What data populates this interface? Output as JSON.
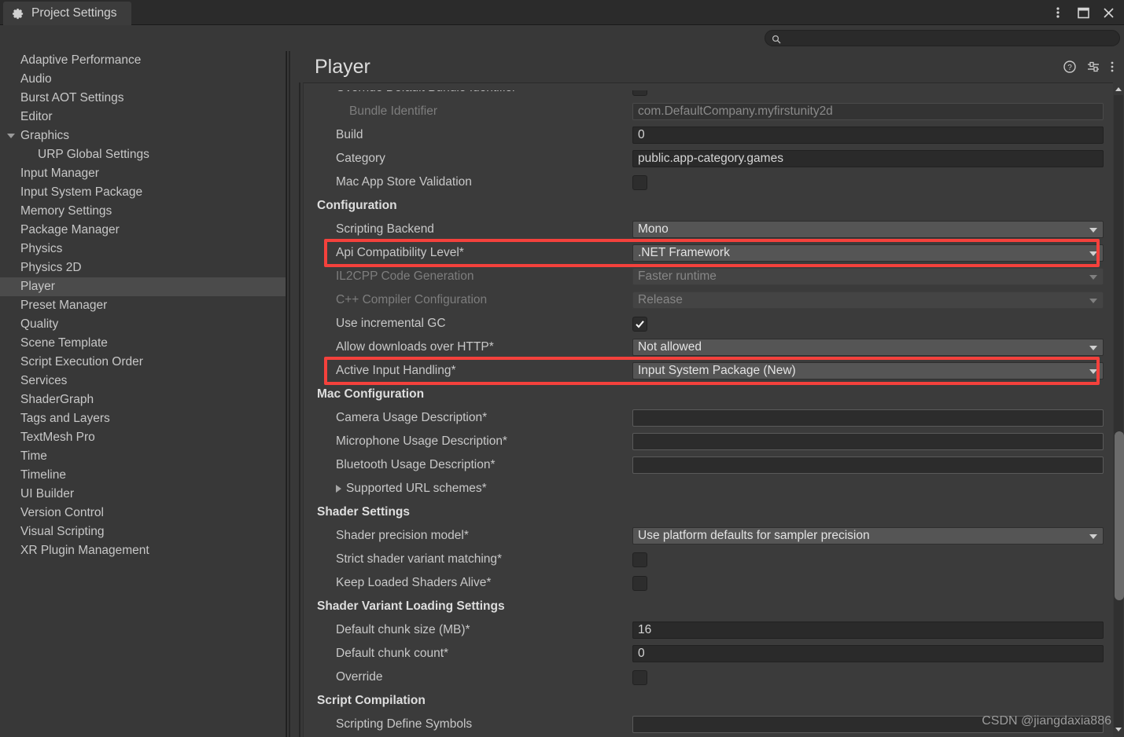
{
  "window": {
    "tab_title": "Project Settings",
    "tab_icon": "gear-icon",
    "controls": {
      "menu": "kebab-menu-icon",
      "maximize": "maximize-icon",
      "close": "close-icon"
    }
  },
  "search": {
    "placeholder": "",
    "value": "",
    "icon": "search-icon"
  },
  "sidebar": {
    "items": [
      {
        "label": "Adaptive Performance",
        "level": 0,
        "expandable": false,
        "selected": false
      },
      {
        "label": "Audio",
        "level": 0,
        "expandable": false,
        "selected": false
      },
      {
        "label": "Burst AOT Settings",
        "level": 0,
        "expandable": false,
        "selected": false
      },
      {
        "label": "Editor",
        "level": 0,
        "expandable": false,
        "selected": false
      },
      {
        "label": "Graphics",
        "level": 0,
        "expandable": true,
        "expanded": true,
        "selected": false
      },
      {
        "label": "URP Global Settings",
        "level": 1,
        "expandable": false,
        "selected": false
      },
      {
        "label": "Input Manager",
        "level": 0,
        "expandable": false,
        "selected": false
      },
      {
        "label": "Input System Package",
        "level": 0,
        "expandable": false,
        "selected": false
      },
      {
        "label": "Memory Settings",
        "level": 0,
        "expandable": false,
        "selected": false
      },
      {
        "label": "Package Manager",
        "level": 0,
        "expandable": false,
        "selected": false
      },
      {
        "label": "Physics",
        "level": 0,
        "expandable": false,
        "selected": false
      },
      {
        "label": "Physics 2D",
        "level": 0,
        "expandable": false,
        "selected": false
      },
      {
        "label": "Player",
        "level": 0,
        "expandable": false,
        "selected": true
      },
      {
        "label": "Preset Manager",
        "level": 0,
        "expandable": false,
        "selected": false
      },
      {
        "label": "Quality",
        "level": 0,
        "expandable": false,
        "selected": false
      },
      {
        "label": "Scene Template",
        "level": 0,
        "expandable": false,
        "selected": false
      },
      {
        "label": "Script Execution Order",
        "level": 0,
        "expandable": false,
        "selected": false
      },
      {
        "label": "Services",
        "level": 0,
        "expandable": false,
        "selected": false
      },
      {
        "label": "ShaderGraph",
        "level": 0,
        "expandable": false,
        "selected": false
      },
      {
        "label": "Tags and Layers",
        "level": 0,
        "expandable": false,
        "selected": false
      },
      {
        "label": "TextMesh Pro",
        "level": 0,
        "expandable": false,
        "selected": false
      },
      {
        "label": "Time",
        "level": 0,
        "expandable": false,
        "selected": false
      },
      {
        "label": "Timeline",
        "level": 0,
        "expandable": false,
        "selected": false
      },
      {
        "label": "UI Builder",
        "level": 0,
        "expandable": false,
        "selected": false
      },
      {
        "label": "Version Control",
        "level": 0,
        "expandable": false,
        "selected": false
      },
      {
        "label": "Visual Scripting",
        "level": 0,
        "expandable": false,
        "selected": false
      },
      {
        "label": "XR Plugin Management",
        "level": 0,
        "expandable": false,
        "selected": false
      }
    ]
  },
  "panel": {
    "title": "Player",
    "header_icons": [
      "help-icon",
      "preset-icon",
      "kebab-menu-icon"
    ],
    "rows": [
      {
        "kind": "checkbox",
        "label": "Override Default Bundle Identifier",
        "indent": 1,
        "checked": false,
        "disabled": false
      },
      {
        "kind": "text",
        "label": "Bundle Identifier",
        "indent": 2,
        "value": "com.DefaultCompany.myfirstunity2d",
        "disabled": true
      },
      {
        "kind": "text",
        "label": "Build",
        "indent": 1,
        "value": "0",
        "disabled": false
      },
      {
        "kind": "text",
        "label": "Category",
        "indent": 1,
        "value": "public.app-category.games",
        "disabled": false
      },
      {
        "kind": "checkbox",
        "label": "Mac App Store Validation",
        "indent": 1,
        "checked": false,
        "disabled": false
      },
      {
        "kind": "section",
        "label": "Configuration"
      },
      {
        "kind": "dropdown",
        "label": "Scripting Backend",
        "indent": 1,
        "value": "Mono",
        "disabled": false
      },
      {
        "kind": "dropdown",
        "label": "Api Compatibility Level*",
        "indent": 1,
        "value": ".NET Framework",
        "disabled": false,
        "highlight": true
      },
      {
        "kind": "dropdown",
        "label": "IL2CPP Code Generation",
        "indent": 1,
        "value": "Faster runtime",
        "disabled": true
      },
      {
        "kind": "dropdown",
        "label": "C++ Compiler Configuration",
        "indent": 1,
        "value": "Release",
        "disabled": true
      },
      {
        "kind": "checkbox",
        "label": "Use incremental GC",
        "indent": 1,
        "checked": true,
        "disabled": false
      },
      {
        "kind": "dropdown",
        "label": "Allow downloads over HTTP*",
        "indent": 1,
        "value": "Not allowed",
        "disabled": false
      },
      {
        "kind": "dropdown",
        "label": "Active Input Handling*",
        "indent": 1,
        "value": "Input System Package (New)",
        "disabled": false,
        "highlight": true
      },
      {
        "kind": "section",
        "label": "Mac Configuration"
      },
      {
        "kind": "text",
        "label": "Camera Usage Description*",
        "indent": 1,
        "value": "",
        "disabled": false
      },
      {
        "kind": "text",
        "label": "Microphone Usage Description*",
        "indent": 1,
        "value": "",
        "disabled": false
      },
      {
        "kind": "text",
        "label": "Bluetooth Usage Description*",
        "indent": 1,
        "value": "",
        "disabled": false
      },
      {
        "kind": "foldout",
        "label": "Supported URL schemes*",
        "indent": 1,
        "expanded": false
      },
      {
        "kind": "section",
        "label": "Shader Settings"
      },
      {
        "kind": "dropdown",
        "label": "Shader precision model*",
        "indent": 1,
        "value": "Use platform defaults for sampler precision",
        "disabled": false
      },
      {
        "kind": "checkbox",
        "label": "Strict shader variant matching*",
        "indent": 1,
        "checked": false,
        "disabled": false
      },
      {
        "kind": "checkbox",
        "label": "Keep Loaded Shaders Alive*",
        "indent": 1,
        "checked": false,
        "disabled": false
      },
      {
        "kind": "section",
        "label": "Shader Variant Loading Settings"
      },
      {
        "kind": "text",
        "label": "Default chunk size (MB)*",
        "indent": 1,
        "value": "16",
        "disabled": false
      },
      {
        "kind": "text",
        "label": "Default chunk count*",
        "indent": 1,
        "value": "0",
        "disabled": false
      },
      {
        "kind": "checkbox",
        "label": "Override",
        "indent": 1,
        "checked": false,
        "disabled": false
      },
      {
        "kind": "section",
        "label": "Script Compilation"
      },
      {
        "kind": "text",
        "label": "Scripting Define Symbols",
        "indent": 1,
        "value": "",
        "disabled": false,
        "clipped": true
      }
    ]
  },
  "annotations": {
    "color": "#f4413c",
    "boxes": [
      {
        "target": "Api Compatibility Level*"
      },
      {
        "target": "Active Input Handling*"
      }
    ]
  },
  "watermark": {
    "text": "CSDN @jiangdaxia886"
  },
  "scrollbar": {
    "position_percent": 53
  }
}
